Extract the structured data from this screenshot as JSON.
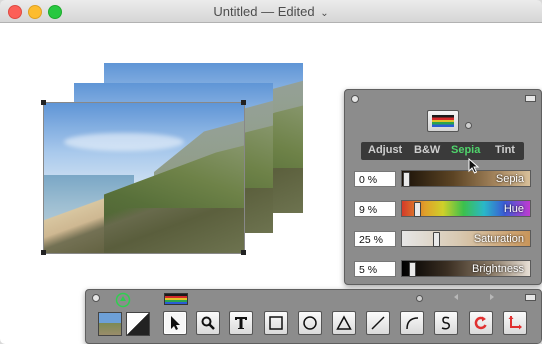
{
  "window": {
    "title": "Untitled — Edited",
    "title_chevron": "⌄"
  },
  "effects_panel": {
    "tabs": [
      {
        "label": "Adjust"
      },
      {
        "label": "B&W"
      },
      {
        "label": "Sepia",
        "active": true
      },
      {
        "label": "Tint"
      }
    ],
    "sliders": [
      {
        "name": "Sepia",
        "value": "0 %",
        "level": 0
      },
      {
        "name": "Hue",
        "value": "9 %",
        "level": 0.09
      },
      {
        "name": "Saturation",
        "value": "25 %",
        "level": 0.25
      },
      {
        "name": "Brightness",
        "value": "5 %",
        "level": 0.05
      }
    ],
    "colors": {
      "active_tab": "#4fd36b"
    }
  },
  "tool_palette": {
    "tools": [
      {
        "name": "select",
        "icon": "arrow-pointer-icon",
        "selected": true
      },
      {
        "name": "zoom",
        "icon": "magnifier-icon"
      },
      {
        "name": "text",
        "icon": "text-icon"
      },
      {
        "name": "rectangle",
        "icon": "rectangle-icon"
      },
      {
        "name": "oval",
        "icon": "circle-icon"
      },
      {
        "name": "triangle",
        "icon": "triangle-icon"
      },
      {
        "name": "line",
        "icon": "line-icon"
      },
      {
        "name": "arc",
        "icon": "arc-icon"
      },
      {
        "name": "freehand",
        "icon": "squiggle-icon"
      },
      {
        "name": "rotate",
        "icon": "rotate-icon"
      },
      {
        "name": "crop",
        "icon": "crop-arrow-icon"
      }
    ]
  }
}
